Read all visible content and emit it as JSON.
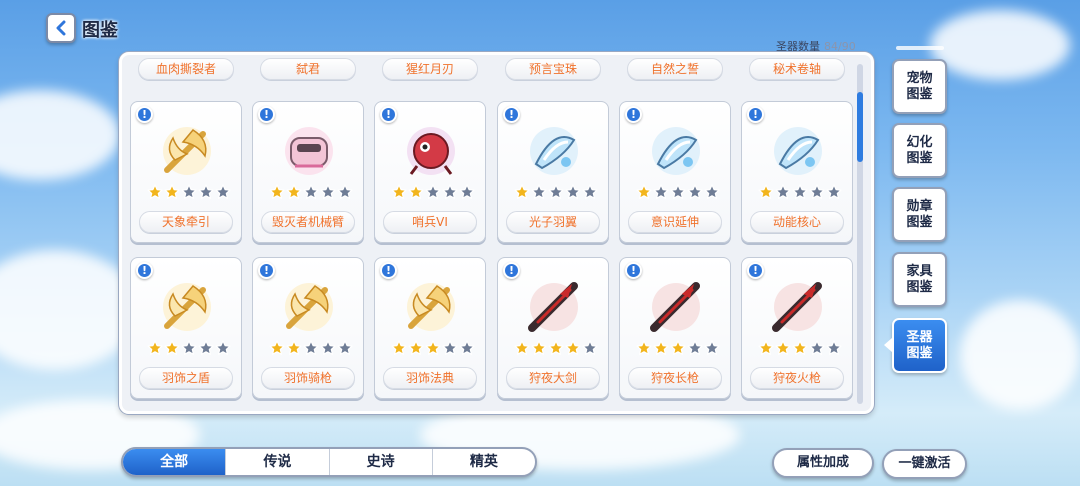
{
  "header": {
    "title": "图鉴"
  },
  "collection": {
    "label": "圣器数量",
    "value": "84/90"
  },
  "top_row": [
    "血肉撕裂者",
    "弑君",
    "猩红月刃",
    "预言宝珠",
    "自然之誓",
    "秘术卷轴"
  ],
  "cards": [
    {
      "name": "天象牵引",
      "stars": 2,
      "theme": "gold"
    },
    {
      "name": "毁灭者机械臂",
      "stars": 2,
      "theme": "pink"
    },
    {
      "name": "哨兵VI",
      "stars": 2,
      "theme": "red"
    },
    {
      "name": "光子羽翼",
      "stars": 1,
      "theme": "ice"
    },
    {
      "name": "意识延伸",
      "stars": 1,
      "theme": "ice"
    },
    {
      "name": "动能核心",
      "stars": 1,
      "theme": "ice"
    },
    {
      "name": "羽饰之盾",
      "stars": 2,
      "theme": "gold"
    },
    {
      "name": "羽饰骑枪",
      "stars": 2,
      "theme": "gold"
    },
    {
      "name": "羽饰法典",
      "stars": 3,
      "theme": "gold"
    },
    {
      "name": "狩夜大剑",
      "stars": 4,
      "theme": "dark"
    },
    {
      "name": "狩夜长枪",
      "stars": 3,
      "theme": "dark"
    },
    {
      "name": "狩夜火枪",
      "stars": 3,
      "theme": "dark"
    }
  ],
  "max_stars": 5,
  "side_menu": [
    {
      "label": "宠物图鉴",
      "active": false
    },
    {
      "label": "幻化图鉴",
      "active": false
    },
    {
      "label": "勋章图鉴",
      "active": false
    },
    {
      "label": "家具图鉴",
      "active": false
    },
    {
      "label": "圣器图鉴",
      "active": true
    }
  ],
  "tabs": [
    {
      "label": "全部",
      "active": true
    },
    {
      "label": "传说",
      "active": false
    },
    {
      "label": "史诗",
      "active": false
    },
    {
      "label": "精英",
      "active": false
    }
  ],
  "buttons": {
    "attribute_bonus": "属性加成",
    "activate_all": "一键激活"
  },
  "alert_glyph": "!",
  "colors": {
    "accent": "#2f76db",
    "item_name": "#f0722c",
    "star_on": "#f2b51d",
    "star_off": "#6f7d96"
  }
}
